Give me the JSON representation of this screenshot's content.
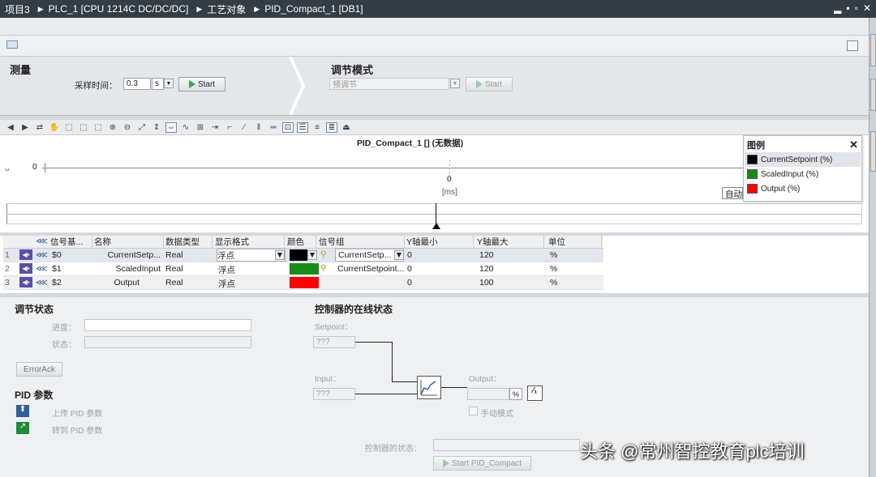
{
  "breadcrumb": {
    "item1": "项目3",
    "item2": "PLC_1 [CPU 1214C DC/DC/DC]",
    "item3": "工艺对象",
    "item4": "PID_Compact_1 [DB1]"
  },
  "window_controls": {
    "minimize": "▂",
    "restore": "▪",
    "maximize": "▫",
    "close": "✕"
  },
  "measure": {
    "title": "测量",
    "sample_time_label": "采样时间：",
    "sample_time_value": "0.3",
    "unit": "s",
    "start": "Start"
  },
  "tuning": {
    "title": "调节模式",
    "mode_value": "预调节",
    "start": "Start"
  },
  "chart": {
    "title": "PID_Compact_1 [] (无数据)",
    "y_tick": "0",
    "x_tick": "0",
    "x_unit": "[ms]",
    "auto_label": "自动"
  },
  "legend": {
    "title": "图例",
    "close": "✕",
    "items": [
      {
        "label": "CurrentSetpoint (%)",
        "color": "#000000"
      },
      {
        "label": "ScaledInput (%)",
        "color": "#1a8a1a"
      },
      {
        "label": "Output (%)",
        "color": "#ff0000"
      }
    ]
  },
  "signal_table": {
    "headers": [
      "信号基...",
      "名称",
      "数据类型",
      "显示格式",
      "颜色",
      "信号组",
      "Y轴最小",
      "Y轴最大",
      "单位"
    ],
    "rows": [
      {
        "num": "1",
        "sig": "$0",
        "name": "CurrentSetp...",
        "type": "Real",
        "fmt": "浮点",
        "color": "#000000",
        "group": "CurrentSetp...",
        "ymin": "0",
        "ymax": "120",
        "unit": "%"
      },
      {
        "num": "2",
        "sig": "$1",
        "name": "ScaledInput",
        "type": "Real",
        "fmt": "浮点",
        "color": "#1a8a1a",
        "group": "CurrentSetpoint...",
        "ymin": "0",
        "ymax": "120",
        "unit": "%"
      },
      {
        "num": "3",
        "sig": "$2",
        "name": "Output",
        "type": "Real",
        "fmt": "浮点",
        "color": "#ff0000",
        "group": "",
        "ymin": "0",
        "ymax": "100",
        "unit": "%"
      }
    ]
  },
  "tuning_status": {
    "title": "调节状态",
    "progress_label": "进度：",
    "status_label": "状态：",
    "error_ack": "ErrorAck"
  },
  "pid_params": {
    "title": "PID 参数",
    "upload": "上传 PID 参数",
    "goto": "转到 PID 参数"
  },
  "online_status": {
    "title": "控制器的在线状态",
    "setpoint_label": "Setpoint：",
    "setpoint_value": "???",
    "input_label": "Input：",
    "input_value": "???",
    "output_label": "Output：",
    "output_unit": "%",
    "manual_mode": "手动模式",
    "controller_state_label": "控制器的状态：",
    "start_button": "Start PID_Compact"
  },
  "watermark": "头条 @常州智控教育plc培训"
}
